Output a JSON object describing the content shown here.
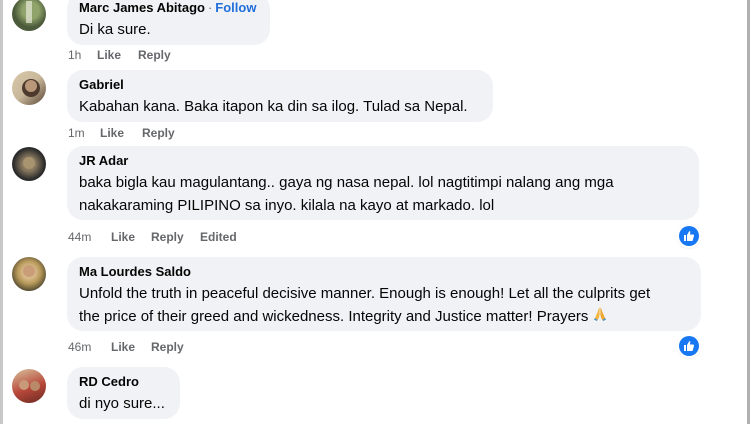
{
  "comments": [
    {
      "name": "Marc James Abitago",
      "follow": "Follow",
      "separator": "·",
      "text": "Di ka sure.",
      "time": "1h",
      "like": "Like",
      "reply": "Reply",
      "avatar_colors": [
        "#4a5a3a",
        "#8fa36a"
      ]
    },
    {
      "name": "Gabriel",
      "text": "Kabahan kana. Baka itapon ka din sa ilog. Tulad sa Nepal.",
      "time": "1m",
      "like": "Like",
      "reply": "Reply",
      "avatar_colors": [
        "#c9b79a",
        "#5a4636"
      ]
    },
    {
      "name": "JR Adar",
      "text_lines": [
        "baka bigla kau magulantang.. gaya ng nasa nepal. lol nagtitimpi nalang ang mga",
        "nakakaraming PILIPINO sa inyo. kilala na kayo at markado. lol"
      ],
      "time": "44m",
      "like": "Like",
      "reply": "Reply",
      "edited": "Edited",
      "reactions": "like-reaction",
      "avatar_colors": [
        "#2b2b2b",
        "#8a7a60"
      ]
    },
    {
      "name": "Ma Lourdes Saldo",
      "text_lines": [
        "Unfold the truth in peaceful decisive manner. Enough is enough! Let all the culprits get",
        "the price of their greed and wickedness. Integrity and Justice matter! Prayers"
      ],
      "emoji": "praying-hands",
      "time": "46m",
      "like": "Like",
      "reply": "Reply",
      "reactions": "like-reaction",
      "avatar_colors": [
        "#b89a5a",
        "#3f3a2a"
      ]
    },
    {
      "name": "RD Cedro",
      "text": "di nyo sure...",
      "avatar_colors": [
        "#b8483a",
        "#d9c3a0"
      ]
    }
  ],
  "colors": {
    "bubble": "#f0f2f5",
    "meta_text": "#65676b",
    "follow": "#216fdb",
    "like_blue": "#1877f2"
  }
}
